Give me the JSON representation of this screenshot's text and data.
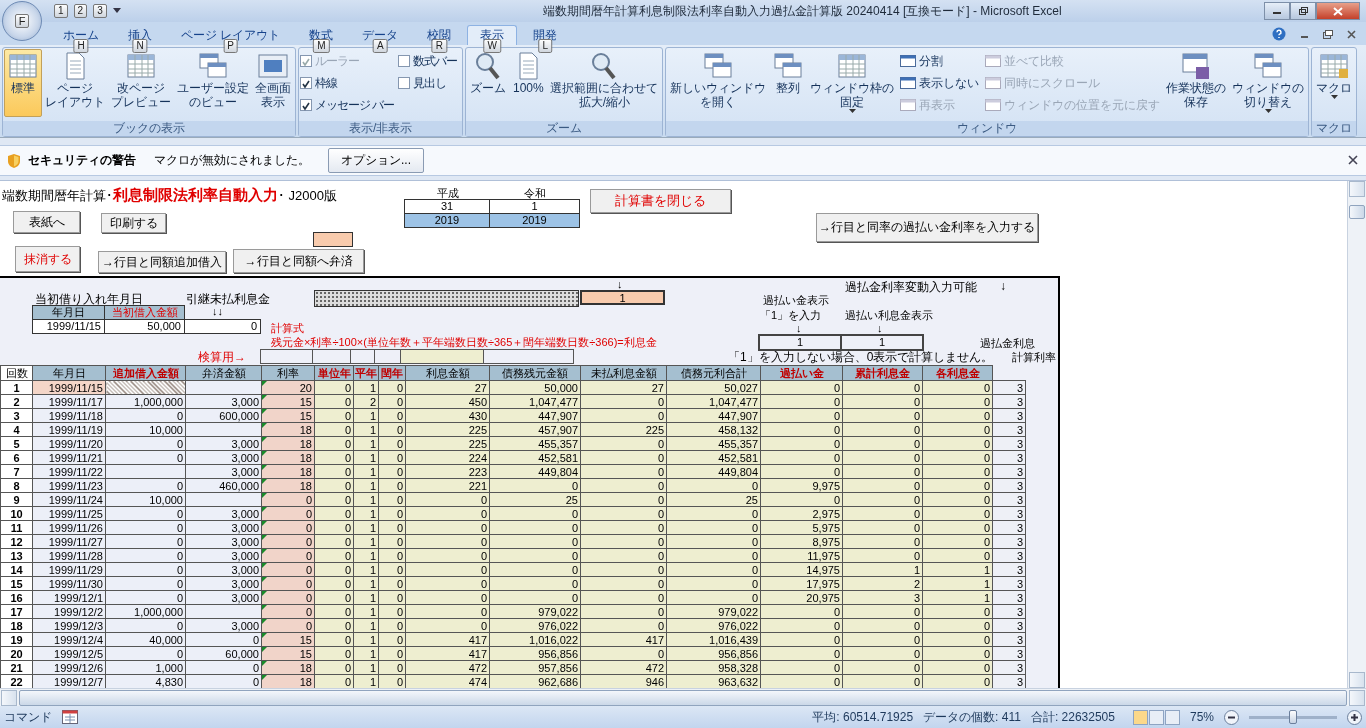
{
  "window": {
    "title": "端数期間暦年計算利息制限法利率自動入力過払金計算版 20240414 [互換モード] - Microsoft Excel",
    "office_keytip": "F",
    "quick_access_keytips": [
      "1",
      "2",
      "3"
    ]
  },
  "tabs": [
    {
      "label": "ホーム",
      "keytip": "H",
      "selected": false
    },
    {
      "label": "挿入",
      "keytip": "N",
      "selected": false
    },
    {
      "label": "ページ レイアウト",
      "keytip": "P",
      "selected": false
    },
    {
      "label": "数式",
      "keytip": "M",
      "selected": false
    },
    {
      "label": "データ",
      "keytip": "A",
      "selected": false
    },
    {
      "label": "校閲",
      "keytip": "R",
      "selected": false
    },
    {
      "label": "表示",
      "keytip": "W",
      "selected": true
    },
    {
      "label": "開発",
      "keytip": "L",
      "selected": false
    }
  ],
  "ribbon": {
    "groups": [
      {
        "title": "ブックの表示",
        "items": [
          {
            "kind": "large",
            "lines": [
              "標準"
            ],
            "selected": true,
            "dropdown": false
          },
          {
            "kind": "large",
            "lines": [
              "ページ",
              "レイアウト"
            ],
            "selected": false,
            "dropdown": false
          },
          {
            "kind": "large",
            "lines": [
              "改ページ",
              "プレビュー"
            ],
            "selected": false,
            "dropdown": false
          },
          {
            "kind": "large",
            "lines": [
              "ユーザー設定",
              "のビュー"
            ],
            "selected": false,
            "dropdown": false
          },
          {
            "kind": "large",
            "lines": [
              "全画面",
              "表示"
            ],
            "selected": false,
            "dropdown": false
          }
        ]
      },
      {
        "title": "表示/非表示",
        "items": [
          {
            "kind": "check",
            "label": "ルーラー",
            "checked": true,
            "disabled": true
          },
          {
            "kind": "check",
            "label": "枠線",
            "checked": true,
            "disabled": false
          },
          {
            "kind": "check",
            "label": "メッセージ バー",
            "checked": true,
            "disabled": false
          },
          {
            "kind": "check",
            "label": "数式バー",
            "checked": false,
            "disabled": false
          },
          {
            "kind": "check",
            "label": "見出し",
            "checked": false,
            "disabled": false
          }
        ]
      },
      {
        "title": "ズーム",
        "items": [
          {
            "kind": "large",
            "lines": [
              "ズーム"
            ],
            "selected": false,
            "dropdown": false
          },
          {
            "kind": "large",
            "lines": [
              "100%"
            ],
            "selected": false,
            "dropdown": false
          },
          {
            "kind": "large",
            "lines": [
              "選択範囲に合わせて",
              "拡大/縮小"
            ],
            "selected": false,
            "dropdown": false
          }
        ]
      },
      {
        "title": "ウィンドウ",
        "items": [
          {
            "kind": "large",
            "lines": [
              "新しいウィンドウ",
              "を開く"
            ],
            "selected": false,
            "dropdown": false
          },
          {
            "kind": "large",
            "lines": [
              "整列"
            ],
            "selected": false,
            "dropdown": false
          },
          {
            "kind": "large",
            "lines": [
              "ウィンドウ枠の",
              "固定"
            ],
            "selected": false,
            "dropdown": true
          },
          {
            "kind": "small",
            "label": "分割",
            "disabled": false
          },
          {
            "kind": "small",
            "label": "表示しない",
            "disabled": false
          },
          {
            "kind": "small",
            "label": "再表示",
            "disabled": true
          },
          {
            "kind": "small",
            "label": "並べて比較",
            "disabled": true
          },
          {
            "kind": "small",
            "label": "同時にスクロール",
            "disabled": true
          },
          {
            "kind": "small",
            "label": "ウィンドウの位置を元に戻す",
            "disabled": true
          },
          {
            "kind": "large",
            "lines": [
              "作業状態の",
              "保存"
            ],
            "selected": false,
            "dropdown": false
          },
          {
            "kind": "large",
            "lines": [
              "ウィンドウの",
              "切り替え"
            ],
            "selected": false,
            "dropdown": true
          }
        ]
      },
      {
        "title": "マクロ",
        "items": [
          {
            "kind": "large",
            "lines": [
              "マクロ"
            ],
            "selected": false,
            "dropdown": true
          }
        ]
      }
    ]
  },
  "security_bar": {
    "title": "セキュリティの警告",
    "message": "マクロが無効にされました。",
    "button": "オプション..."
  },
  "sheet": {
    "title": "端数期間暦年計算･**利息制限法利率自動入力**･ J2000版",
    "era_table": {
      "headers": [
        "平成",
        "令和"
      ],
      "years": [
        "31",
        "1"
      ],
      "western": [
        "2019",
        "2019"
      ]
    },
    "close_button": "計算書を閉じる",
    "cover_button": "表紙へ",
    "print_button": "印刷する",
    "erase_button": "抹消する",
    "same_loan_button": "→行目と同額追加借入",
    "same_repay_button": "→行目と同額へ弁済",
    "same_rate_button": "→行目と同率の過払い金利率を入力する",
    "top_arrow": "↓",
    "rate_variable_label": "過払金利率変動入力可能",
    "rate_variable_arrow": "↓",
    "rate_input": "1",
    "loan_date_label": "当初借り入れ年月日",
    "carry_label": "引継未払利息金",
    "carry_arrows": "↓↓",
    "initial_table": {
      "headers": [
        "年月日",
        "当初借入金額"
      ],
      "values": [
        "1999/11/15",
        "50,000",
        "0"
      ]
    },
    "overpay_display_label": "過払い金表示",
    "input_label": "「1」を入力",
    "overpay_interest_label": "過払い利息金表示",
    "flag_arrows": [
      "↓",
      "↓"
    ],
    "flags": [
      "1",
      "1"
    ],
    "formula_title": "計算式",
    "formula": "残元金×利率÷100×(単位年数＋平年端数日数÷365＋閏年端数日数÷366)=利息金",
    "interest_label": "過払金利息",
    "note": "「1」を入力しない場合、0表示で計算しません。",
    "calc_rate_label": "計算利率",
    "check_label": "検算用→"
  },
  "table": {
    "columns": [
      {
        "label": "回数",
        "highlight": false
      },
      {
        "label": "年月日",
        "highlight": false
      },
      {
        "label": "追加借入金額",
        "highlight": true
      },
      {
        "label": "弁済金額",
        "highlight": false
      },
      {
        "label": "利率",
        "highlight": false
      },
      {
        "label": "単位年",
        "highlight": true
      },
      {
        "label": "平年",
        "highlight": true
      },
      {
        "label": "閏年",
        "highlight": true
      },
      {
        "label": "利息金額",
        "highlight": false
      },
      {
        "label": "債務残元金額",
        "highlight": false
      },
      {
        "label": "未払利息金額",
        "highlight": false
      },
      {
        "label": "債務元利合計",
        "highlight": false
      },
      {
        "label": "過払い金",
        "highlight": true
      },
      {
        "label": "累計利息金",
        "highlight": true
      },
      {
        "label": "各利息金",
        "highlight": true
      }
    ],
    "rows": [
      {
        "initial": true,
        "cells": [
          "1",
          "1999/11/15",
          null,
          null,
          "20",
          "0",
          "1",
          "0",
          "27",
          "50,000",
          "27",
          "50,027",
          "0",
          "0",
          "0",
          "3"
        ]
      },
      {
        "initial": false,
        "cells": [
          "2",
          "1999/11/17",
          "1,000,000",
          "3,000",
          "15",
          "0",
          "2",
          "0",
          "450",
          "1,047,477",
          "0",
          "1,047,477",
          "0",
          "0",
          "0",
          "3"
        ]
      },
      {
        "initial": false,
        "cells": [
          "3",
          "1999/11/18",
          "0",
          "600,000",
          "15",
          "0",
          "1",
          "0",
          "430",
          "447,907",
          "0",
          "447,907",
          "0",
          "0",
          "0",
          "3"
        ]
      },
      {
        "initial": false,
        "cells": [
          "4",
          "1999/11/19",
          "10,000",
          null,
          "18",
          "0",
          "1",
          "0",
          "225",
          "457,907",
          "225",
          "458,132",
          "0",
          "0",
          "0",
          "3"
        ]
      },
      {
        "initial": false,
        "cells": [
          "5",
          "1999/11/20",
          "0",
          "3,000",
          "18",
          "0",
          "1",
          "0",
          "225",
          "455,357",
          "0",
          "455,357",
          "0",
          "0",
          "0",
          "3"
        ]
      },
      {
        "initial": false,
        "cells": [
          "6",
          "1999/11/21",
          "0",
          "3,000",
          "18",
          "0",
          "1",
          "0",
          "224",
          "452,581",
          "0",
          "452,581",
          "0",
          "0",
          "0",
          "3"
        ]
      },
      {
        "initial": false,
        "cells": [
          "7",
          "1999/11/22",
          null,
          "3,000",
          "18",
          "0",
          "1",
          "0",
          "223",
          "449,804",
          "0",
          "449,804",
          "0",
          "0",
          "0",
          "3"
        ]
      },
      {
        "initial": false,
        "cells": [
          "8",
          "1999/11/23",
          "0",
          "460,000",
          "18",
          "0",
          "1",
          "0",
          "221",
          "0",
          "0",
          "0",
          "9,975",
          "0",
          "0",
          "3"
        ]
      },
      {
        "initial": false,
        "cells": [
          "9",
          "1999/11/24",
          "10,000",
          null,
          "0",
          "0",
          "1",
          "0",
          "0",
          "25",
          "0",
          "25",
          "0",
          "0",
          "0",
          "3"
        ]
      },
      {
        "initial": false,
        "cells": [
          "10",
          "1999/11/25",
          "0",
          "3,000",
          "0",
          "0",
          "1",
          "0",
          "0",
          "0",
          "0",
          "0",
          "2,975",
          "0",
          "0",
          "3"
        ]
      },
      {
        "initial": false,
        "cells": [
          "11",
          "1999/11/26",
          "0",
          "3,000",
          "0",
          "0",
          "1",
          "0",
          "0",
          "0",
          "0",
          "0",
          "5,975",
          "0",
          "0",
          "3"
        ]
      },
      {
        "initial": false,
        "cells": [
          "12",
          "1999/11/27",
          "0",
          "3,000",
          "0",
          "0",
          "1",
          "0",
          "0",
          "0",
          "0",
          "0",
          "8,975",
          "0",
          "0",
          "3"
        ]
      },
      {
        "initial": false,
        "cells": [
          "13",
          "1999/11/28",
          "0",
          "3,000",
          "0",
          "0",
          "1",
          "0",
          "0",
          "0",
          "0",
          "0",
          "11,975",
          "0",
          "0",
          "3"
        ]
      },
      {
        "initial": false,
        "cells": [
          "14",
          "1999/11/29",
          "0",
          "3,000",
          "0",
          "0",
          "1",
          "0",
          "0",
          "0",
          "0",
          "0",
          "14,975",
          "1",
          "1",
          "3"
        ]
      },
      {
        "initial": false,
        "cells": [
          "15",
          "1999/11/30",
          "0",
          "3,000",
          "0",
          "0",
          "1",
          "0",
          "0",
          "0",
          "0",
          "0",
          "17,975",
          "2",
          "1",
          "3"
        ]
      },
      {
        "initial": false,
        "cells": [
          "16",
          "1999/12/1",
          "0",
          "3,000",
          "0",
          "0",
          "1",
          "0",
          "0",
          "0",
          "0",
          "0",
          "20,975",
          "3",
          "1",
          "3"
        ]
      },
      {
        "initial": false,
        "cells": [
          "17",
          "1999/12/2",
          "1,000,000",
          null,
          "0",
          "0",
          "1",
          "0",
          "0",
          "979,022",
          "0",
          "979,022",
          "0",
          "0",
          "0",
          "3"
        ]
      },
      {
        "initial": false,
        "cells": [
          "18",
          "1999/12/3",
          "0",
          "3,000",
          "0",
          "0",
          "1",
          "0",
          "0",
          "976,022",
          "0",
          "976,022",
          "0",
          "0",
          "0",
          "3"
        ]
      },
      {
        "initial": false,
        "cells": [
          "19",
          "1999/12/4",
          "40,000",
          "0",
          "15",
          "0",
          "1",
          "0",
          "417",
          "1,016,022",
          "417",
          "1,016,439",
          "0",
          "0",
          "0",
          "3"
        ]
      },
      {
        "initial": false,
        "cells": [
          "20",
          "1999/12/5",
          "0",
          "60,000",
          "15",
          "0",
          "1",
          "0",
          "417",
          "956,856",
          "0",
          "956,856",
          "0",
          "0",
          "0",
          "3"
        ]
      },
      {
        "initial": false,
        "cells": [
          "21",
          "1999/12/6",
          "1,000",
          "0",
          "18",
          "0",
          "1",
          "0",
          "472",
          "957,856",
          "472",
          "958,328",
          "0",
          "0",
          "0",
          "3"
        ]
      },
      {
        "initial": false,
        "cells": [
          "22",
          "1999/12/7",
          "4,830",
          "0",
          "18",
          "0",
          "1",
          "0",
          "474",
          "962,686",
          "946",
          "963,632",
          "0",
          "0",
          "0",
          "3"
        ]
      }
    ]
  },
  "status_bar": {
    "mode": "コマンド",
    "average": "平均: 60514.71925",
    "count": "データの個数: 411",
    "sum": "合計: 22632505",
    "zoom": "75%",
    "zoom_slider": {
      "level": 0.5
    }
  }
}
